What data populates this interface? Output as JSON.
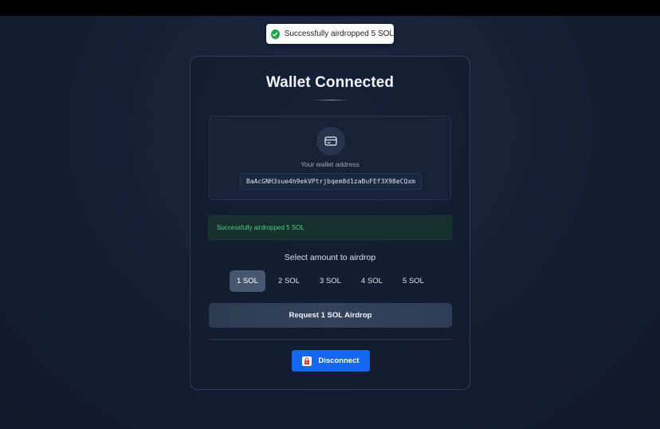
{
  "toast": {
    "icon": "check-circle-icon",
    "message": "Successfully airdropped 5 SOL"
  },
  "card": {
    "title": "Wallet Connected",
    "wallet": {
      "icon": "wallet-icon",
      "label": "Your wallet address",
      "address": "BaAcGNH3sue4h9ekVPtrjbqem8d1zaBuFEf3X98eCQxm"
    },
    "status_message": "Successfully airdropped 5 SOL",
    "amount_label": "Select amount to airdrop",
    "amounts": [
      {
        "label": "1 SOL",
        "selected": true
      },
      {
        "label": "2 SOL",
        "selected": false
      },
      {
        "label": "3 SOL",
        "selected": false
      },
      {
        "label": "4 SOL",
        "selected": false
      },
      {
        "label": "5 SOL",
        "selected": false
      }
    ],
    "request_label": "Request 1 SOL Airdrop",
    "disconnect": {
      "icon": "disconnect-icon",
      "label": "Disconnect"
    }
  },
  "colors": {
    "accent": "#1366f0",
    "success": "#4fd37f",
    "toast_check": "#1ea44b",
    "selected_amount_bg": "#475770"
  }
}
